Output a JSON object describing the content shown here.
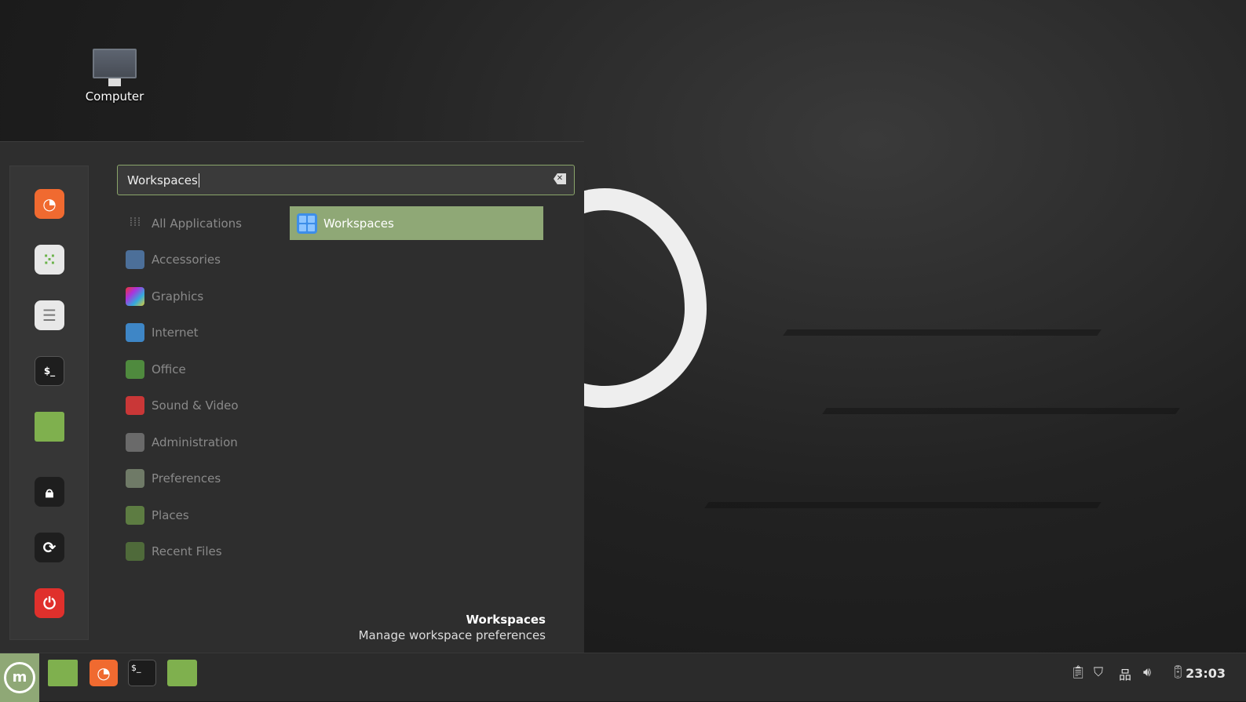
{
  "desktop": {
    "icons": [
      {
        "label": "Computer"
      }
    ]
  },
  "menu": {
    "search": {
      "value": "Workspaces",
      "clear_icon": "clear-text-icon"
    },
    "favorites": [
      {
        "name": "firefox"
      },
      {
        "name": "software-manager"
      },
      {
        "name": "system-settings"
      },
      {
        "name": "terminal"
      },
      {
        "name": "files"
      },
      {
        "name": "lock-screen"
      },
      {
        "name": "logout"
      },
      {
        "name": "shutdown"
      }
    ],
    "categories": [
      "All Applications",
      "Accessories",
      "Graphics",
      "Internet",
      "Office",
      "Sound & Video",
      "Administration",
      "Preferences",
      "Places",
      "Recent Files"
    ],
    "results": [
      {
        "label": "Workspaces"
      }
    ],
    "description": {
      "title": "Workspaces",
      "text": "Manage workspace preferences"
    }
  },
  "taskbar": {
    "launchers": [
      "show-desktop",
      "firefox",
      "terminal",
      "files"
    ],
    "tray": [
      "clipboard",
      "update-manager",
      "network",
      "volume",
      "power"
    ],
    "clock": "23:03"
  },
  "colors": {
    "accent": "#8fa876"
  }
}
